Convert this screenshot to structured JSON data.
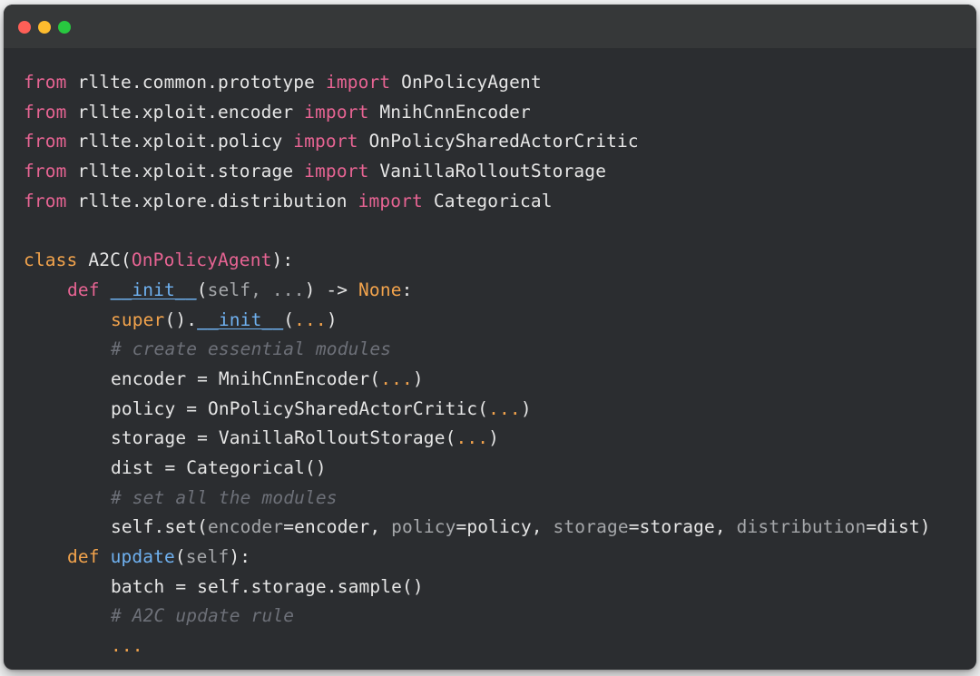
{
  "window": {
    "controls": [
      "close",
      "minimize",
      "maximize"
    ]
  },
  "code": {
    "line1": {
      "k1": "from",
      "mod": " rllte.common.prototype ",
      "k2": "import",
      "name": " OnPolicyAgent"
    },
    "line2": {
      "k1": "from",
      "mod": " rllte.xploit.encoder ",
      "k2": "import",
      "name": " MnihCnnEncoder"
    },
    "line3": {
      "k1": "from",
      "mod": " rllte.xploit.policy ",
      "k2": "import",
      "name": " OnPolicySharedActorCritic"
    },
    "line4": {
      "k1": "from",
      "mod": " rllte.xploit.storage ",
      "k2": "import",
      "name": " VanillaRolloutStorage"
    },
    "line5": {
      "k1": "from",
      "mod": " rllte.xplore.distribution ",
      "k2": "import",
      "name": " Categorical"
    },
    "line7": {
      "k": "class",
      "name": " A2C(",
      "base": "OnPolicyAgent",
      "end": "):"
    },
    "line8": {
      "k": "def",
      "fn": "__init__",
      "open": "(",
      "args": "self, ...",
      "arrow": ") -> ",
      "ret": "None",
      "colon": ":"
    },
    "line9": {
      "sup": "super",
      "mid": "().",
      "fn": "__init__",
      "open": "(",
      "el": "...",
      "close": ")"
    },
    "line10": {
      "comment": "# create essential modules"
    },
    "line11": {
      "lhs": "encoder = MnihCnnEncoder(",
      "el": "...",
      "close": ")"
    },
    "line12": {
      "lhs": "policy = OnPolicySharedActorCritic(",
      "el": "...",
      "close": ")"
    },
    "line13": {
      "lhs": "storage = VanillaRolloutStorage(",
      "el": "...",
      "close": ")"
    },
    "line14": {
      "text": "dist = Categorical()"
    },
    "line15": {
      "comment": "# set all the modules"
    },
    "line16": {
      "pre": "self.set(",
      "p1": "encoder",
      "v1": "=encoder, ",
      "p2": "policy",
      "v2": "=policy, ",
      "p3": "storage",
      "v3": "=storage, ",
      "p4": "distribution",
      "v4": "=dist)"
    },
    "line17": {
      "k": "def",
      "fn": "update",
      "open": "(",
      "args": "self",
      "end": "):"
    },
    "line18": {
      "text": "batch = self.storage.sample()"
    },
    "line19": {
      "comment": "# A2C update rule"
    },
    "line20": {
      "el": "..."
    }
  },
  "colors": {
    "background": "#2b2d30",
    "titlebar": "#363839",
    "keyword": "#e76493",
    "keyword_alt": "#f2a34c",
    "function": "#6fb1f0",
    "comment": "#6d7078",
    "text": "#e6e6e6"
  }
}
